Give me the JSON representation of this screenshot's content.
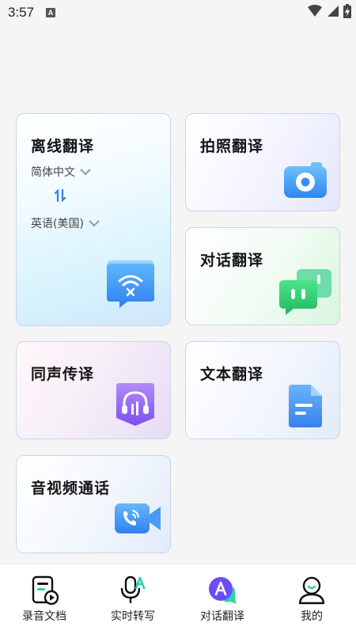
{
  "status_bar": {
    "time": "3:57",
    "notification_badge": "A"
  },
  "cards": {
    "offline": {
      "title": "离线翻译",
      "source_language": "简体中文",
      "target_language": "英语(美国)",
      "icon": "wifi-off-icon"
    },
    "photo": {
      "title": "拍照翻译",
      "icon": "camera-icon"
    },
    "dialog": {
      "title": "对话翻译",
      "icon": "chat-bubbles-icon"
    },
    "simultaneous": {
      "title": "同声传译",
      "icon": "headphones-icon"
    },
    "text": {
      "title": "文本翻译",
      "icon": "document-icon"
    },
    "video_call": {
      "title": "音视频通话",
      "icon": "video-call-icon"
    }
  },
  "bottom_nav": {
    "items": [
      {
        "label": "录音文档",
        "icon": "recording-doc-icon"
      },
      {
        "label": "实时转写",
        "icon": "mic-transcribe-icon"
      },
      {
        "label": "对话翻译",
        "icon": "dialog-translate-icon"
      },
      {
        "label": "我的",
        "icon": "profile-icon"
      }
    ]
  },
  "colors": {
    "accent_blue": "#3d8cf0",
    "accent_green": "#28c56a",
    "accent_purple": "#8a5cf6"
  }
}
